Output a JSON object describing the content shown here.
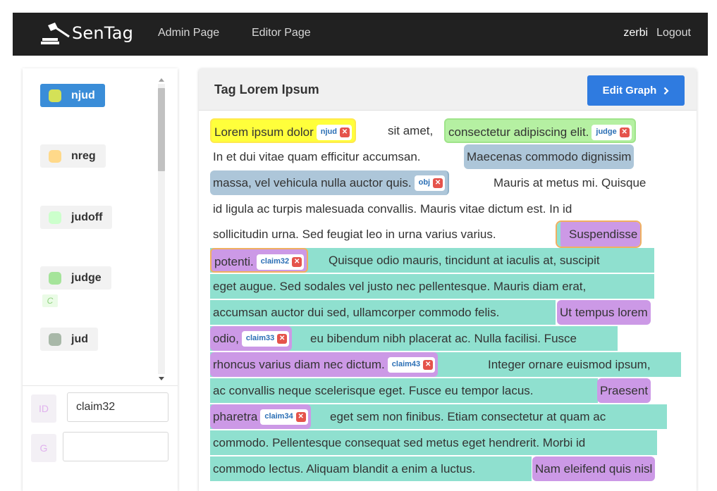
{
  "navbar": {
    "brand": "SenTag",
    "links": [
      "Admin Page",
      "Editor Page"
    ],
    "user": "zerbi",
    "logout": "Logout"
  },
  "sidebar": {
    "tags": [
      {
        "label": "njud",
        "color": "#d4e157",
        "active": true
      },
      {
        "label": "nreg",
        "color": "#ffd98a",
        "active": false
      },
      {
        "label": "judoff",
        "color": "#ccffcc",
        "active": false
      },
      {
        "label": "judge",
        "color": "#a5e49a",
        "active": false,
        "sub": "C"
      },
      {
        "label": "jud",
        "color": "#a8b8a8",
        "active": false
      }
    ],
    "id_label": "ID",
    "id_value": "claim32",
    "g_label": "G",
    "g_value": ""
  },
  "panel": {
    "title": "Tag Lorem Ipsum",
    "edit_button": "Edit Graph",
    "edit_icon": "chevron-right-icon",
    "chip_close_icon": "close-icon"
  },
  "colors": {
    "njud": "#ffff3b",
    "judge": "#b5f0a2",
    "obj": "#adc6d9",
    "claim": "#cc99e6",
    "premise": "#8fe0cf"
  },
  "text": {
    "l1a": "Lorem ipsum dolor",
    "chip_njud": "njud",
    "l1b": "sit amet,",
    "l1c": "consectetur adipiscing elit.",
    "chip_judge": "judge",
    "l2a": "In et dui vitae quam efficitur accumsan.",
    "l2b": "Maecenas commodo dignissim",
    "l3a": "massa, vel vehicula nulla auctor quis.",
    "chip_obj": "obj",
    "l3b": "Mauris at metus mi. Quisque",
    "l4": "id ligula ac turpis malesuada convallis. Mauris vitae dictum est. In id",
    "l5a": "sollicitudin urna. Sed feugiat leo in urna varius varius.",
    "l5b": "Suspendisse",
    "l6a": "potenti.",
    "chip_claim32": "claim32",
    "l6b": "Quisque odio mauris, tincidunt at iaculis at, suscipit",
    "l7": "eget augue. Sed sodales vel justo nec pellentesque. Mauris diam erat,",
    "l8a": "accumsan auctor dui sed, ullamcorper commodo felis.",
    "l8b": "Ut tempus lorem",
    "l9a": "odio,",
    "chip_claim33": "claim33",
    "l9b": "eu bibendum nibh placerat ac. Nulla facilisi. Fusce",
    "l10a": "rhoncus varius diam nec dictum.",
    "chip_claim43": "claim43",
    "l10b": "Integer ornare euismod ipsum,",
    "l11a": "ac convallis neque scelerisque eget.  Fusce eu tempor lacus.",
    "l11b": "Praesent",
    "l12a": "pharetra",
    "chip_claim34": "claim34",
    "l12b": "eget sem non finibus. Etiam consectetur at quam ac",
    "l13": "commodo. Pellentesque consequat sed metus eget hendrerit. Morbi id",
    "l14a": "commodo lectus. Aliquam blandit a enim a luctus.",
    "l14b": "Nam eleifend quis nisl"
  }
}
